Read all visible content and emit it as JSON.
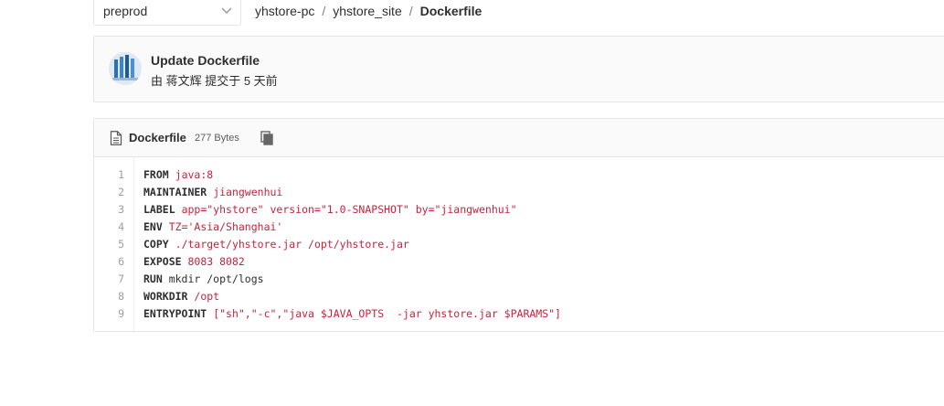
{
  "branch": {
    "selected": "preprod"
  },
  "breadcrumb": {
    "items": [
      "yhstore-pc",
      "yhstore_site"
    ],
    "current": "Dockerfile"
  },
  "commit": {
    "title": "Update Dockerfile",
    "meta": "由 蒋文辉 提交于 5 天前"
  },
  "file": {
    "name": "Dockerfile",
    "size": "277 Bytes"
  },
  "code": {
    "line_numbers": [
      "1",
      "2",
      "3",
      "4",
      "5",
      "6",
      "7",
      "8",
      "9"
    ],
    "lines": [
      [
        {
          "t": "kw",
          "v": "FROM"
        },
        {
          "t": "plain",
          "v": " "
        },
        {
          "t": "str",
          "v": "java:8"
        }
      ],
      [
        {
          "t": "kw",
          "v": "MAINTAINER"
        },
        {
          "t": "plain",
          "v": " "
        },
        {
          "t": "str",
          "v": "jiangwenhui"
        }
      ],
      [
        {
          "t": "kw",
          "v": "LABEL"
        },
        {
          "t": "plain",
          "v": " "
        },
        {
          "t": "str",
          "v": "app=\"yhstore\" version=\"1.0-SNAPSHOT\" by=\"jiangwenhui\""
        }
      ],
      [
        {
          "t": "kw",
          "v": "ENV"
        },
        {
          "t": "plain",
          "v": " "
        },
        {
          "t": "str",
          "v": "TZ='Asia/Shanghai'"
        }
      ],
      [
        {
          "t": "kw",
          "v": "COPY"
        },
        {
          "t": "plain",
          "v": " "
        },
        {
          "t": "str",
          "v": "./target/yhstore.jar /opt/yhstore.jar"
        }
      ],
      [
        {
          "t": "kw",
          "v": "EXPOSE"
        },
        {
          "t": "plain",
          "v": " "
        },
        {
          "t": "str",
          "v": "8083 8082"
        }
      ],
      [
        {
          "t": "kw",
          "v": "RUN"
        },
        {
          "t": "plain",
          "v": " mkdir /opt/logs"
        }
      ],
      [
        {
          "t": "kw",
          "v": "WORKDIR"
        },
        {
          "t": "plain",
          "v": " "
        },
        {
          "t": "str",
          "v": "/opt"
        }
      ],
      [
        {
          "t": "kw",
          "v": "ENTRYPOINT"
        },
        {
          "t": "plain",
          "v": " "
        },
        {
          "t": "str",
          "v": "[\"sh\",\"-c\",\"java $JAVA_OPTS  -jar yhstore.jar $PARAMS\"]"
        }
      ]
    ]
  },
  "colors": {
    "string": "#c6233d",
    "keyword": "#2e2e2e",
    "border": "#e5e5e5",
    "panel_bg": "#fafafa"
  },
  "icons": {
    "branch_chevron": "chevron-down-icon",
    "file": "file-icon",
    "copy": "copy-icon",
    "avatar": "avatar-image"
  }
}
